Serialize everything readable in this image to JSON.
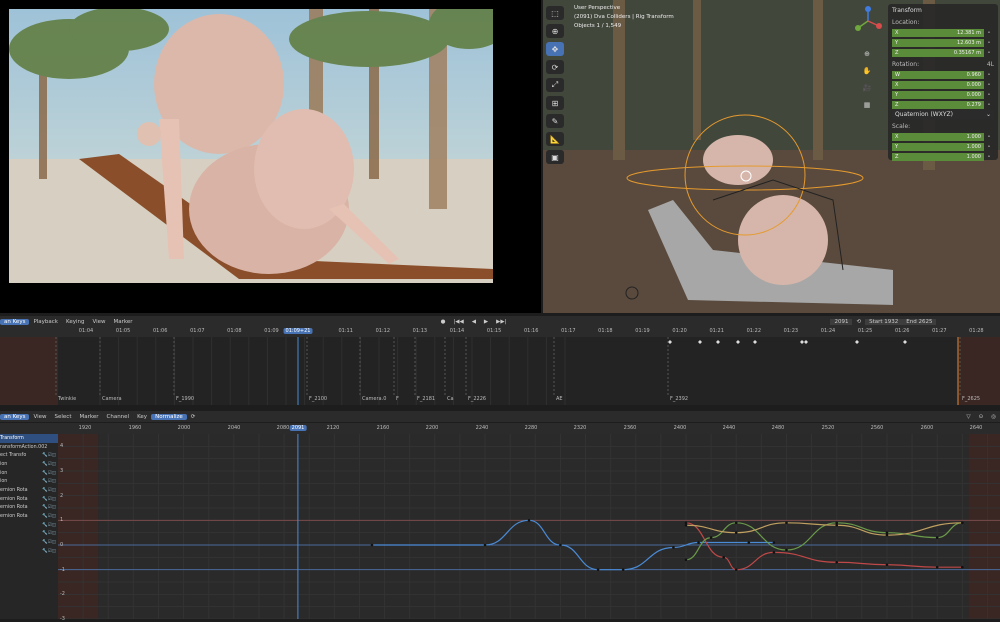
{
  "render_view": {},
  "viewport": {
    "info": [
      "User Perspective",
      "(2091) Dva Colliders | Rig Transform",
      "Objects   1 / 1,549"
    ],
    "tools": [
      "select",
      "cursor",
      "move",
      "rotate",
      "scale",
      "transform",
      "annotate",
      "measure",
      "add-cube"
    ],
    "npanel": {
      "title": "Transform",
      "location_label": "Location:",
      "location": [
        {
          "axis": "X",
          "value": "12.381 m"
        },
        {
          "axis": "Y",
          "value": "12.603 m"
        },
        {
          "axis": "Z",
          "value": "0.35167 m"
        }
      ],
      "rotation_label": "Rotation:",
      "rotation_mode_short": "4L",
      "rotation": [
        {
          "axis": "W",
          "value": "0.960"
        },
        {
          "axis": "X",
          "value": "0.000"
        },
        {
          "axis": "Y",
          "value": "0.000"
        },
        {
          "axis": "Z",
          "value": "0.279"
        }
      ],
      "rotation_mode": "Quaternion (WXYZ)",
      "scale_label": "Scale:",
      "scale": [
        {
          "axis": "X",
          "value": "1.000"
        },
        {
          "axis": "Y",
          "value": "1.000"
        },
        {
          "axis": "Z",
          "value": "1.000"
        }
      ]
    }
  },
  "timeline": {
    "header": {
      "editor": "an Keys",
      "menus": [
        "Playback",
        "Keying",
        "View",
        "Marker"
      ],
      "current_frame": "2091",
      "start_label": "Start",
      "start": "1932",
      "end_label": "End",
      "end": "2625"
    },
    "ticks": [
      "01:04",
      "01:05",
      "01:06",
      "01:07",
      "01:08",
      "01:09",
      "01:09+21",
      "01:11",
      "01:12",
      "01:13",
      "01:14",
      "01:15",
      "01:16",
      "01:17",
      "01:18",
      "01:19",
      "01:20",
      "01:21",
      "01:22",
      "01:23",
      "01:24",
      "01:25",
      "01:26",
      "01:27",
      "01:28"
    ],
    "markers": [
      "Twinkie",
      "Camera",
      "F_1990",
      "F_2100",
      "Camera.0",
      "F",
      "F_2181",
      "Ca",
      "F_2226",
      "AE",
      "F_2392",
      "F_2625"
    ]
  },
  "graph": {
    "header": {
      "editor": "an Keys",
      "menus": [
        "View",
        "Select",
        "Marker",
        "Channel",
        "Key"
      ],
      "normalize": "Normalize"
    },
    "ticks": [
      "1920",
      "1960",
      "2000",
      "2040",
      "2080",
      "2091",
      "2120",
      "2160",
      "2200",
      "2240",
      "2280",
      "2320",
      "2360",
      "2400",
      "2440",
      "2480",
      "2520",
      "2560",
      "2600",
      "2640"
    ],
    "y_labels": [
      "4",
      "3",
      "2",
      "1",
      "0",
      "-1",
      "-2",
      "-3"
    ],
    "channels": [
      "Transform",
      "ransformAction.002",
      "ect Transfo",
      "ion",
      "ion",
      "ion",
      "ernion Rota",
      "ernion Rota",
      "ernion Rota",
      "ernion Rota",
      "",
      "",
      "",
      ""
    ],
    "chart_data": {
      "type": "line",
      "title": "",
      "xlabel": "",
      "ylabel": "",
      "xlim": [
        1900,
        2650
      ],
      "ylim": [
        -3,
        4.5
      ],
      "normalized": true,
      "series": [
        {
          "color": "#4a8bd6",
          "x": [
            2150,
            2240,
            2275,
            2300,
            2330,
            2350,
            2390,
            2410,
            2450,
            2470
          ],
          "y": [
            0,
            0,
            1,
            0,
            -1,
            -1,
            -0.1,
            0.1,
            0.1,
            0.1
          ]
        },
        {
          "color": "#c04848",
          "x": [
            2400,
            2430,
            2440,
            2470,
            2520,
            2560,
            2600,
            2620
          ],
          "y": [
            0.9,
            -0.5,
            -1,
            -0.3,
            -0.7,
            -0.8,
            -0.9,
            -0.9
          ]
        },
        {
          "color": "#6a9a4a",
          "x": [
            2400,
            2420,
            2440,
            2480,
            2520,
            2560,
            2600,
            2620
          ],
          "y": [
            -0.6,
            0.3,
            0.9,
            -0.2,
            0.9,
            0.5,
            0.3,
            0.9
          ]
        },
        {
          "color": "#c0a060",
          "x": [
            2400,
            2440,
            2480,
            2520,
            2560,
            2620
          ],
          "y": [
            0.8,
            0.5,
            0.9,
            0.8,
            0.4,
            0.9
          ]
        }
      ]
    }
  }
}
